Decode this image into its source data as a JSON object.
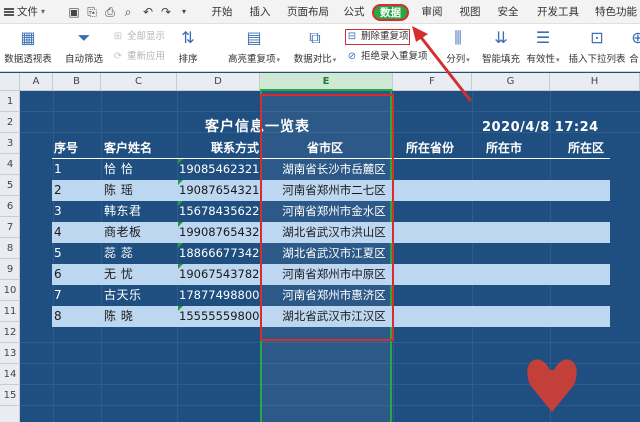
{
  "menubar": {
    "file_label": "文件",
    "tabs": [
      "开始",
      "插入",
      "页面布局",
      "公式",
      "数据",
      "审阅",
      "视图",
      "安全",
      "开发工具",
      "特色功能"
    ],
    "active_tab": "数据"
  },
  "toolbar": {
    "pivot": "数据透视表",
    "autofilter": "自动筛选",
    "show_all": "全部显示",
    "reapply": "重新应用",
    "sort": "排序",
    "highlight_dup": "高亮重复项",
    "compare": "数据对比",
    "remove_dup": "删除重复项",
    "reject_dup": "拒绝录入重复项",
    "split": "分列",
    "smart_fill": "智能填充",
    "validity": "有效性",
    "dropdown": "插入下拉列表",
    "merge": "合"
  },
  "columns": [
    "A",
    "B",
    "C",
    "D",
    "E",
    "F",
    "G",
    "H"
  ],
  "rows": [
    "1",
    "2",
    "3",
    "4",
    "5",
    "6",
    "7",
    "8",
    "9",
    "10",
    "11",
    "12",
    "13",
    "14",
    "15"
  ],
  "sheet": {
    "title": "客户信息一览表",
    "datetime": "2020/4/8  17:24",
    "headers": {
      "no": "序号",
      "name": "客户姓名",
      "phone": "联系方式",
      "address": "省市区",
      "province": "所在省份",
      "city": "所在市",
      "district": "所在区"
    },
    "records": [
      {
        "no": "1",
        "name": "恰  恰",
        "phone": "19085462321",
        "address": "湖南省长沙市岳麓区"
      },
      {
        "no": "2",
        "name": "陈  瑶",
        "phone": "19087654321",
        "address": "河南省郑州市二七区"
      },
      {
        "no": "3",
        "name": "韩东君",
        "phone": "15678435622",
        "address": "河南省郑州市金水区"
      },
      {
        "no": "4",
        "name": "商老板",
        "phone": "19908765432",
        "address": "湖北省武汉市洪山区"
      },
      {
        "no": "5",
        "name": "蕊  蕊",
        "phone": "18866677342",
        "address": "湖北省武汉市江夏区"
      },
      {
        "no": "6",
        "name": "无  忧",
        "phone": "19067543782",
        "address": "河南省郑州市中原区"
      },
      {
        "no": "7",
        "name": "古天乐",
        "phone": "17877498800",
        "address": "河南省郑州市惠济区"
      },
      {
        "no": "8",
        "name": "陈  晓",
        "phone": "15555559800",
        "address": "湖北省武汉市江汉区"
      }
    ]
  },
  "colors": {
    "sheet_bg": "#1f4f80",
    "row_light": "#bdd7f0",
    "active_tab": "#27a845",
    "annotation": "#d32f2f"
  }
}
